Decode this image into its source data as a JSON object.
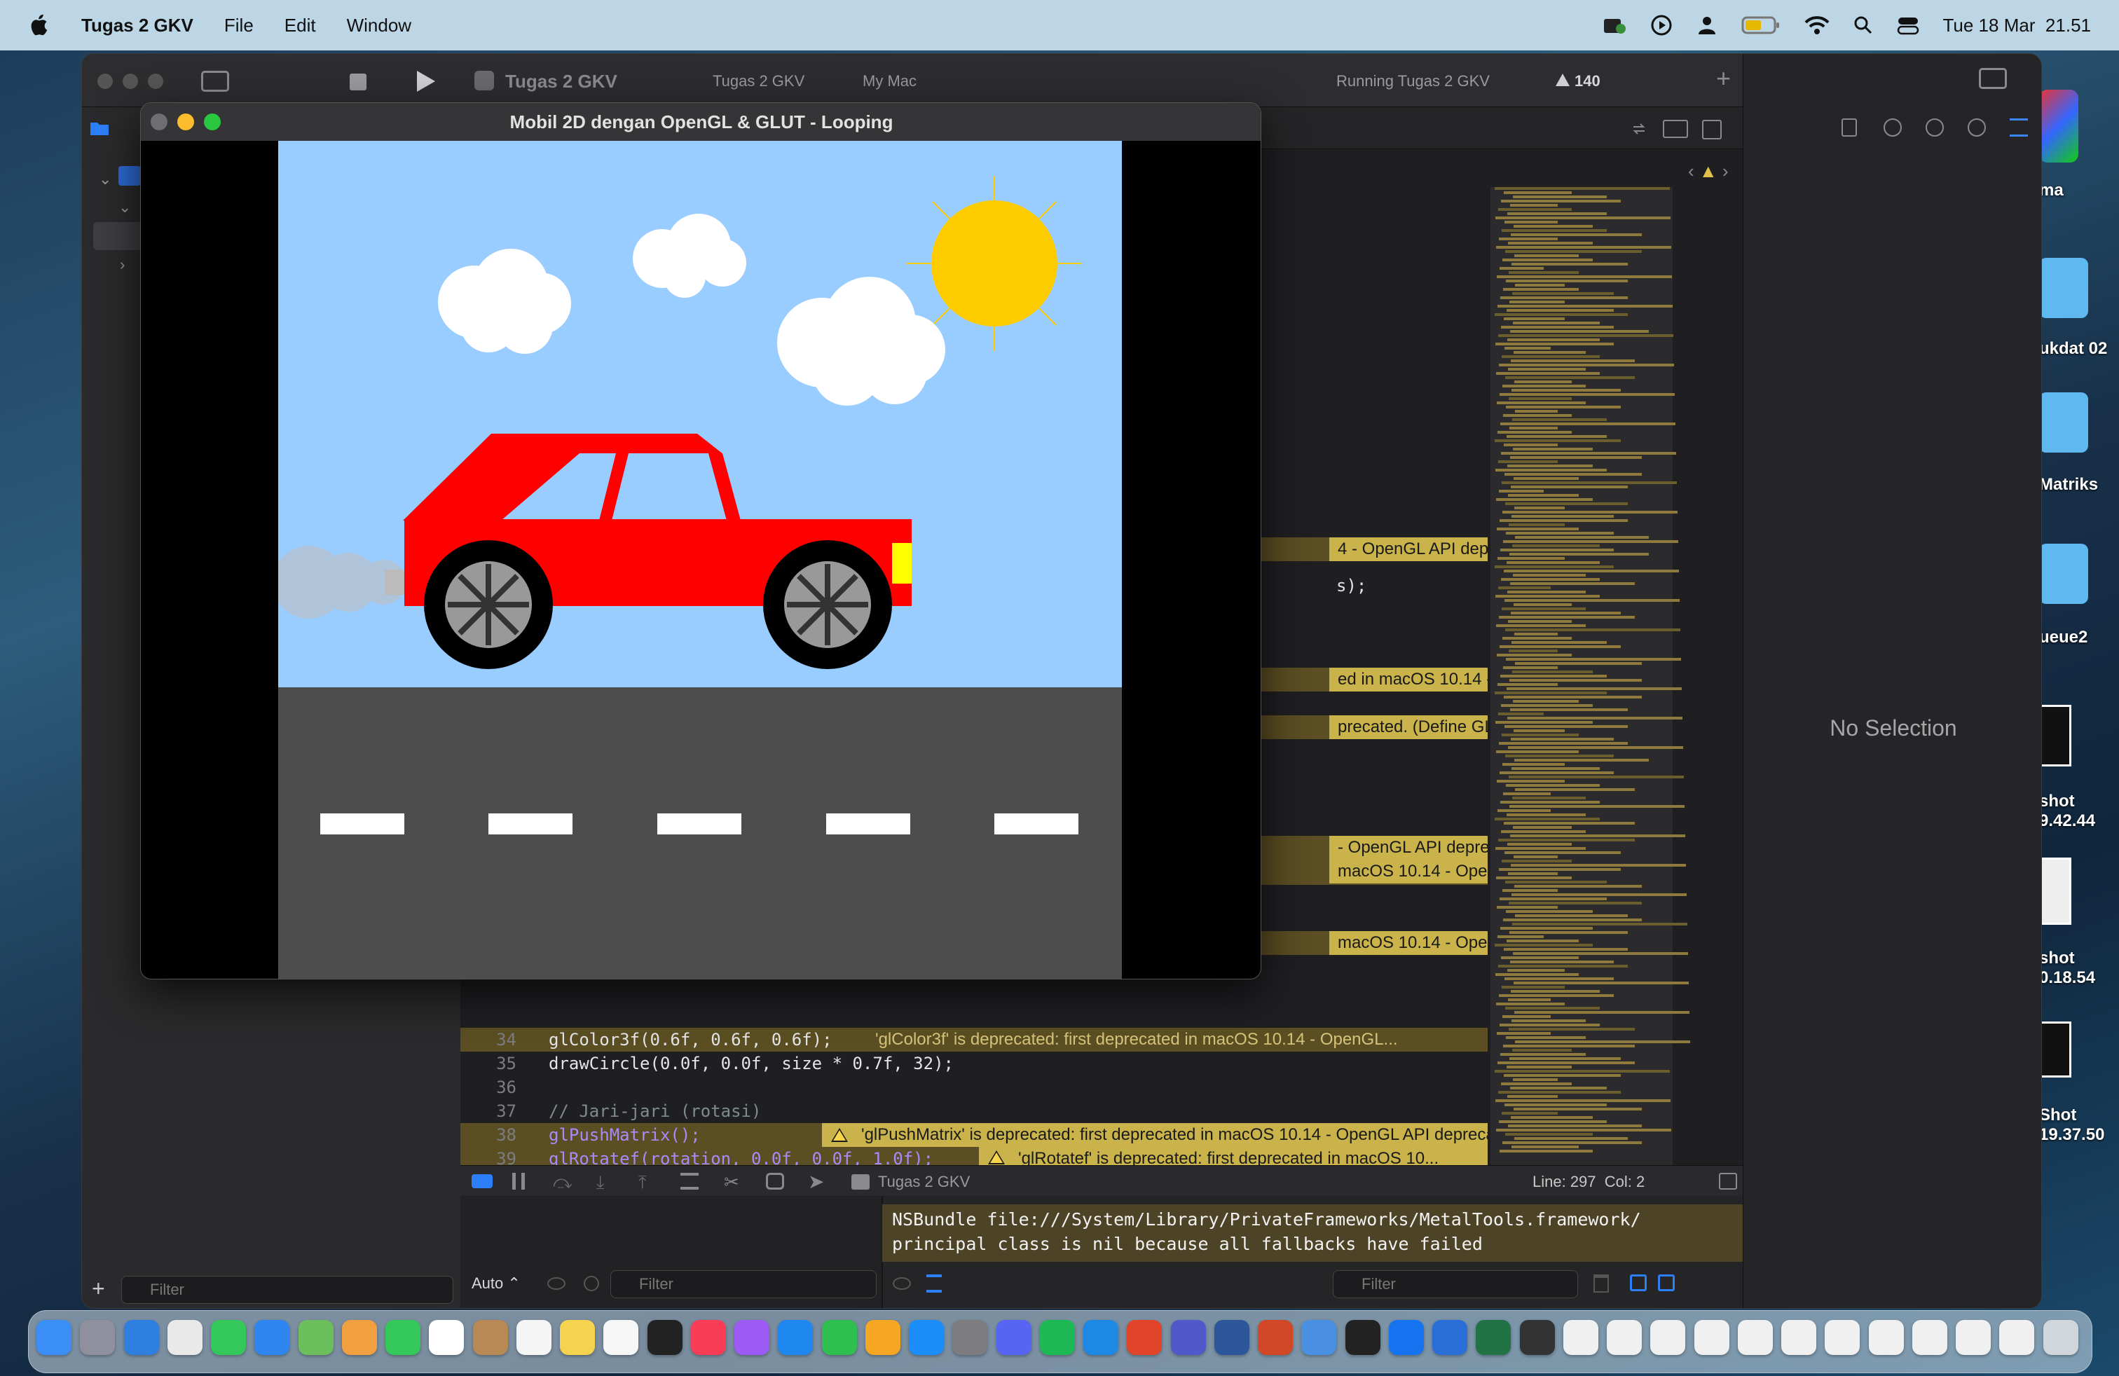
{
  "menubar": {
    "app_name": "Tugas 2 GKV",
    "menus": [
      "File",
      "Edit",
      "Window"
    ],
    "clock": "Tue 18 Mar  21.51"
  },
  "desktop": {
    "icons": [
      "ma",
      "ukdat 02",
      "Matriks",
      "ueue2",
      "shot\n9.42.44",
      "shot\n0.18.54",
      "Shot\n19.37.50"
    ]
  },
  "xcode": {
    "toolbar": {
      "project": "Tugas 2 GKV",
      "scheme": "Tugas 2 GKV",
      "destination": "My Mac",
      "status": "Running Tugas 2 GKV",
      "warning_count": "140"
    },
    "inspector": {
      "placeholder": "No Selection"
    },
    "warnings": [
      "4 - OpenGL API depreca...",
      "s);",
      "ed in macOS 10.14 - Op...",
      "precated. (Define GL_S...",
      "- OpenGL API deprecat...",
      "macOS 10.14 - OpenGL...",
      "macOS 10.14 - OpenGL..."
    ],
    "code_lines": [
      {
        "num": "34",
        "code": "glColor3f(0.6f, 0.6f, 0.6f);",
        "warning": "'glColor3f' is deprecated: first deprecated in macOS 10.14 - OpenGL..."
      },
      {
        "num": "35",
        "code": "drawCircle(0.0f, 0.0f, size * 0.7f, 32);",
        "warning": ""
      },
      {
        "num": "36",
        "code": "",
        "warning": ""
      },
      {
        "num": "37",
        "code": "// Jari-jari (rotasi)",
        "warning": ""
      },
      {
        "num": "38",
        "code": "glPushMatrix();",
        "warning": "'glPushMatrix' is deprecated: first deprecated in macOS 10.14 - OpenGL API deprecat..."
      },
      {
        "num": "39",
        "code": "glRotatef(rotation, 0.0f, 0.0f, 1.0f);",
        "warning": "'glRotatef' is deprecated: first deprecated in macOS 10..."
      }
    ],
    "debug": {
      "target": "Tugas 2 GKV",
      "position": "Line: 297  Col: 2"
    },
    "console": {
      "message_line1": "NSBundle file:///System/Library/PrivateFrameworks/MetalTools.framework/",
      "message_line2": "principal class is nil because all fallbacks have failed",
      "auto_label": "Auto",
      "filter_placeholder": "Filter"
    },
    "navigator": {
      "filter_placeholder": "Filter"
    }
  },
  "glut_window": {
    "title": "Mobil 2D dengan OpenGL & GLUT - Looping"
  },
  "colors": {
    "sky": "#99ccff",
    "road": "#4d4d4d",
    "car": "#ff0000",
    "sun": "#ffcc00",
    "warning_bg": "#c9b34a"
  }
}
